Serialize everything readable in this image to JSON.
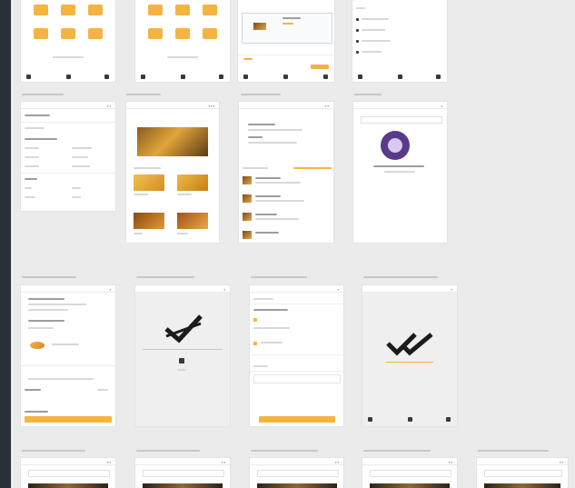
{
  "canvas": {
    "background": "#ebebeb",
    "accent_color": "#f4b342",
    "sidebar_color": "#2b2f36"
  },
  "frames": [
    {
      "id": "r1c1",
      "title": "",
      "icon": "category-grid"
    },
    {
      "id": "r1c2",
      "title": "",
      "icon": "category-grid"
    },
    {
      "id": "r1c3",
      "title": "",
      "icon": "promo-card"
    },
    {
      "id": "r1c4",
      "title": "",
      "icon": "menu-list"
    },
    {
      "id": "r2c1",
      "title": "",
      "icon": "form"
    },
    {
      "id": "r2c2",
      "title": "",
      "icon": "food-grid"
    },
    {
      "id": "r2c3",
      "title": "",
      "icon": "list-thumbs"
    },
    {
      "id": "r2c4",
      "title": "",
      "icon": "empty-cart"
    },
    {
      "id": "r3c1",
      "title": "",
      "icon": "checkout"
    },
    {
      "id": "r3c2",
      "title": "",
      "icon": "success-check"
    },
    {
      "id": "r3c3",
      "title": "",
      "icon": "form-button"
    },
    {
      "id": "r3c4",
      "title": "",
      "icon": "double-check"
    },
    {
      "id": "r4c1",
      "title": "",
      "icon": "screen"
    },
    {
      "id": "r4c2",
      "title": "",
      "icon": "screen"
    },
    {
      "id": "r4c3",
      "title": "",
      "icon": "screen"
    },
    {
      "id": "r4c4",
      "title": "",
      "icon": "screen"
    },
    {
      "id": "r4c5",
      "title": "",
      "icon": "screen"
    }
  ]
}
